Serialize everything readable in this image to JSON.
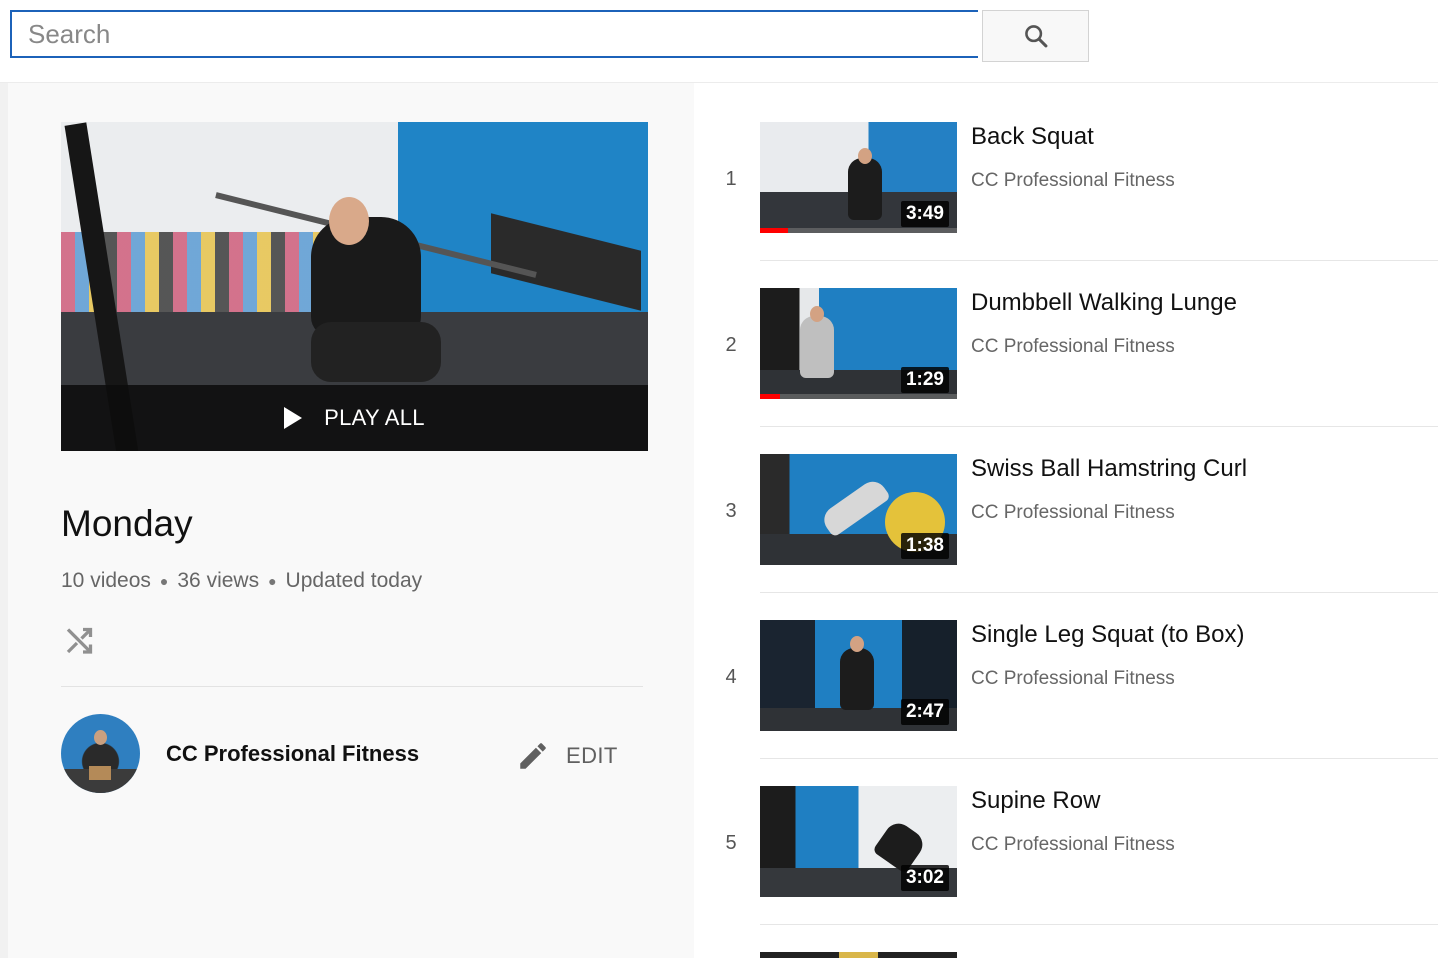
{
  "search": {
    "placeholder": "Search",
    "icon": "search-icon"
  },
  "playlist": {
    "play_all_label": "PLAY ALL",
    "title": "Monday",
    "stats": [
      "10 videos",
      "36 views",
      "Updated today"
    ],
    "shuffle_icon": "shuffle-icon",
    "owner": "CC Professional Fitness",
    "edit_label": "EDIT",
    "edit_icon": "pencil-icon"
  },
  "videos": [
    {
      "index": "1",
      "title": "Back Squat",
      "channel": "CC Professional Fitness",
      "duration": "3:49",
      "watched_fraction": 0.14
    },
    {
      "index": "2",
      "title": "Dumbbell Walking Lunge",
      "channel": "CC Professional Fitness",
      "duration": "1:29",
      "watched_fraction": 0.1
    },
    {
      "index": "3",
      "title": "Swiss Ball Hamstring Curl",
      "channel": "CC Professional Fitness",
      "duration": "1:38",
      "watched_fraction": 0
    },
    {
      "index": "4",
      "title": "Single Leg Squat (to Box)",
      "channel": "CC Professional Fitness",
      "duration": "2:47",
      "watched_fraction": 0
    },
    {
      "index": "5",
      "title": "Supine Row",
      "channel": "CC Professional Fitness",
      "duration": "3:02",
      "watched_fraction": 0
    }
  ],
  "colors": {
    "accent_blue": "#1c62b9",
    "progress_red": "#ff0000",
    "wall_blue": "#1f84c6"
  }
}
